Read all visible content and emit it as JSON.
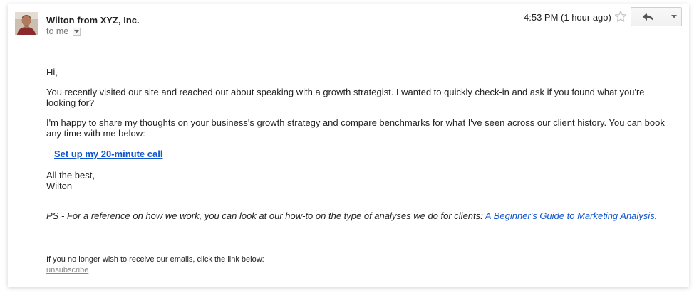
{
  "header": {
    "sender": "Wilton from XYZ, Inc.",
    "recipient": "to me",
    "timestamp": "4:53 PM (1 hour ago)"
  },
  "icons": {
    "avatar": "avatar-photo",
    "recipient_dropdown": "chevron-down-icon",
    "star": "star-icon",
    "reply": "reply-icon",
    "more": "chevron-down-icon"
  },
  "message": {
    "greeting": "Hi,",
    "paragraph1": "You recently visited our site and reached out about speaking with a growth strategist. I wanted to quickly check-in and ask if you found what you're looking for?",
    "paragraph2": "I'm happy to share my thoughts on your business's growth strategy and compare benchmarks for what I've seen across our client history. You can book any time with me below:",
    "cta_link": "Set up my 20-minute call",
    "signoff": "All the best,",
    "signature": "Wilton",
    "ps_text": "PS - For a reference on how we work, you can look at our how-to on the type of analyses we do for clients: ",
    "ps_link": "A Beginner's Guide to Marketing Analysis",
    "ps_end": "."
  },
  "footer": {
    "notice": "If you no longer wish to receive our emails, click the link below:",
    "unsubscribe": "unsubscribe"
  },
  "colors": {
    "link": "#1155cc",
    "muted": "#777777",
    "text": "#222222"
  }
}
